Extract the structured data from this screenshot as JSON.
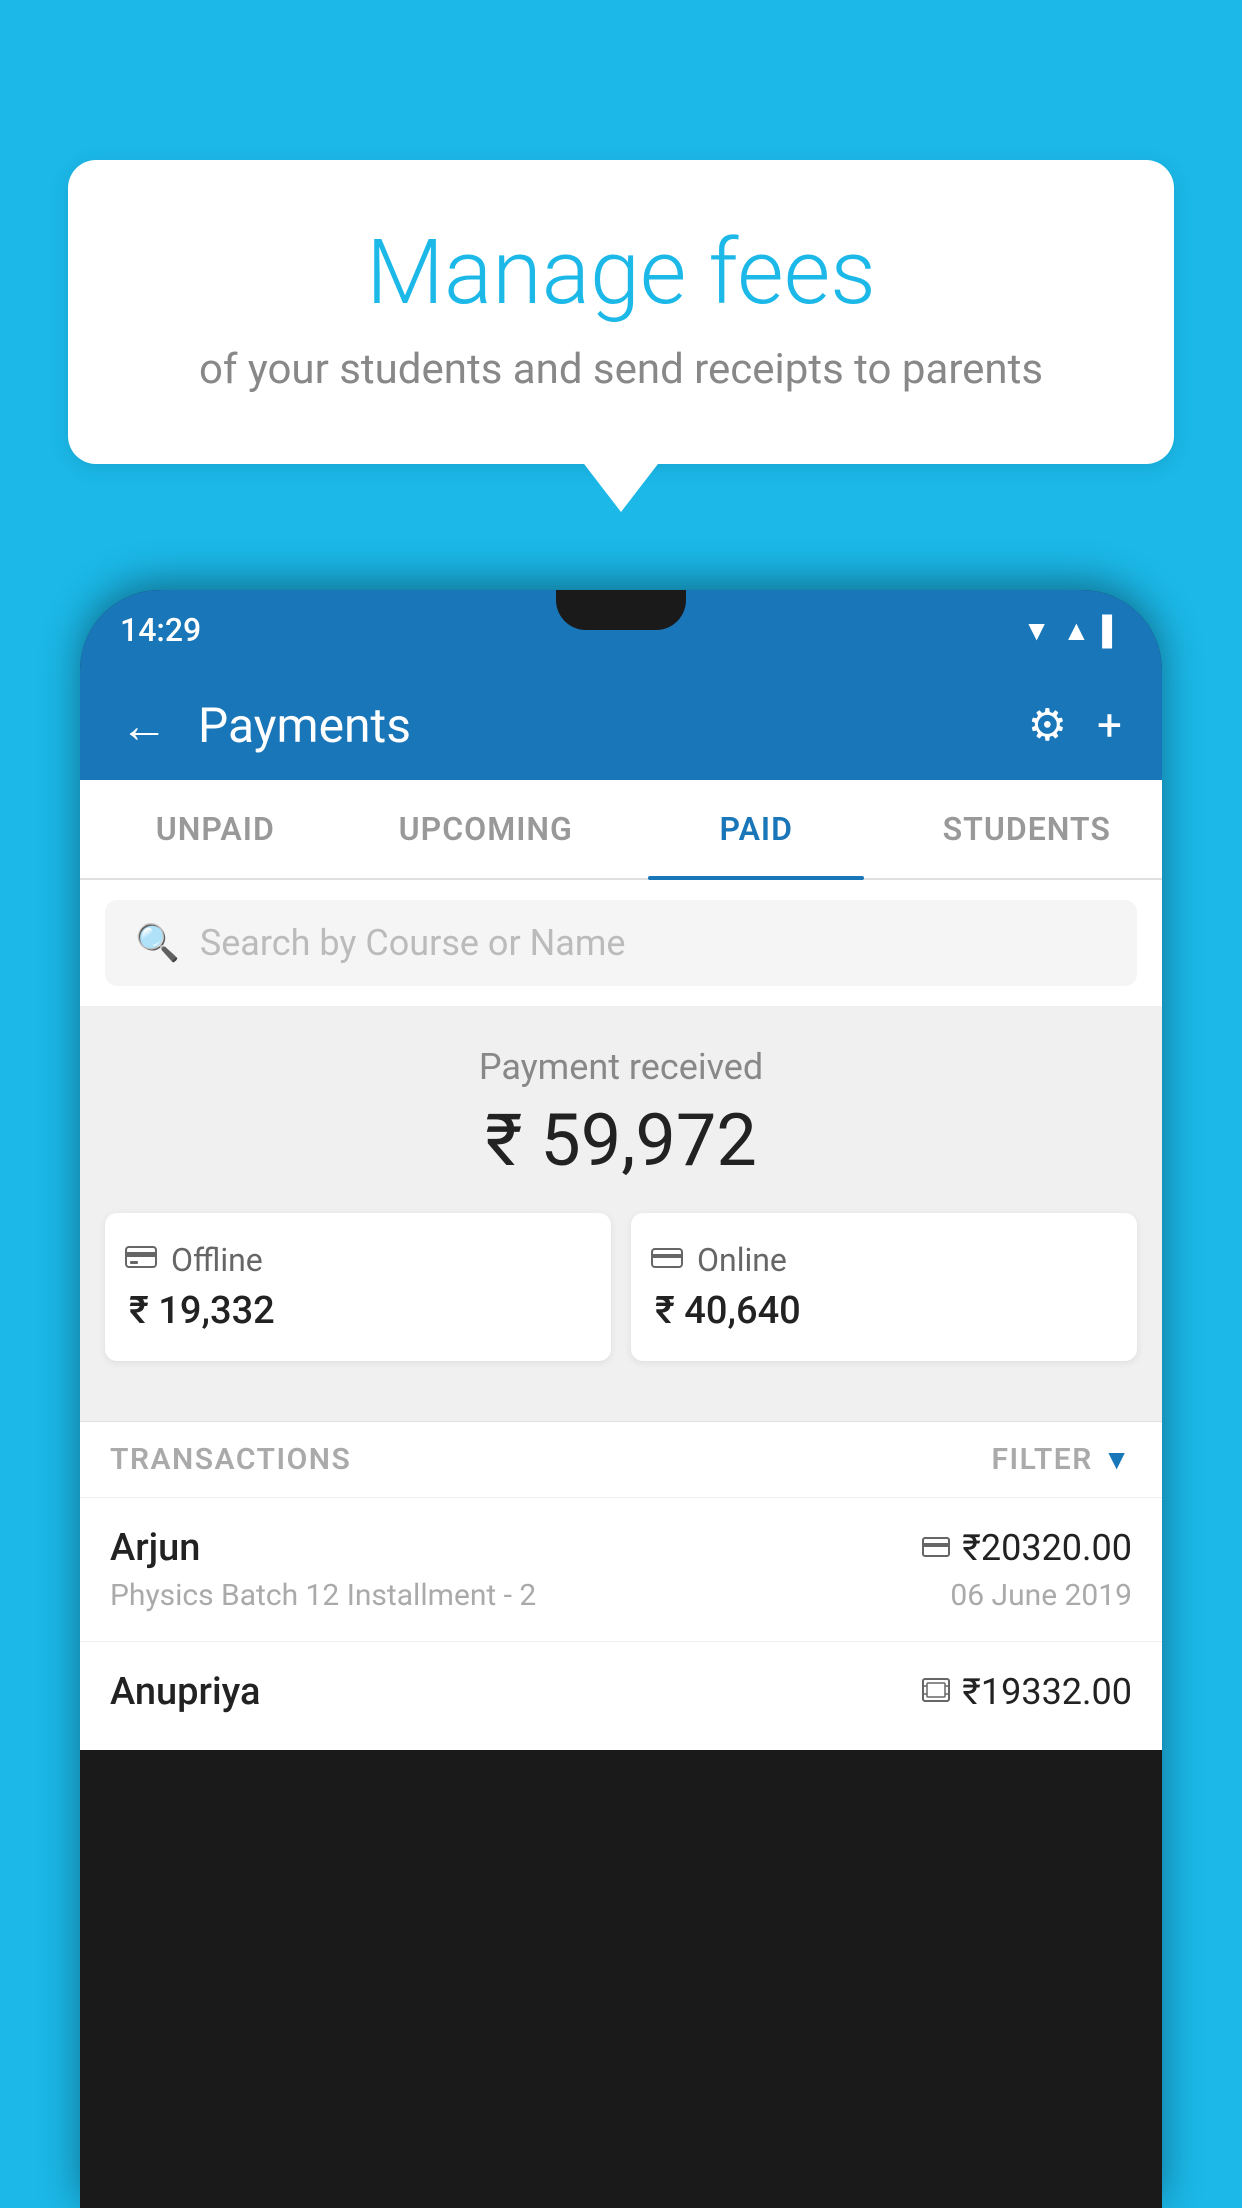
{
  "background_color": "#1BB8E8",
  "bubble": {
    "title": "Manage fees",
    "subtitle": "of your students and send receipts to parents"
  },
  "status_bar": {
    "time": "14:29",
    "icons": [
      "▼",
      "▲",
      "▌"
    ]
  },
  "header": {
    "title": "Payments",
    "back_label": "←",
    "gear_label": "⚙",
    "plus_label": "+"
  },
  "tabs": [
    {
      "label": "UNPAID",
      "active": false
    },
    {
      "label": "UPCOMING",
      "active": false
    },
    {
      "label": "PAID",
      "active": true
    },
    {
      "label": "STUDENTS",
      "active": false
    }
  ],
  "search": {
    "placeholder": "Search by Course or Name"
  },
  "payment_summary": {
    "label": "Payment received",
    "total": "₹ 59,972",
    "offline": {
      "icon": "💳",
      "label": "Offline",
      "amount": "₹ 19,332"
    },
    "online": {
      "icon": "💳",
      "label": "Online",
      "amount": "₹ 40,640"
    }
  },
  "transactions": {
    "label": "TRANSACTIONS",
    "filter_label": "FILTER",
    "rows": [
      {
        "name": "Arjun",
        "amount": "₹20320.00",
        "course": "Physics Batch 12 Installment - 2",
        "date": "06 June 2019",
        "icon_type": "card"
      },
      {
        "name": "Anupriya",
        "amount": "₹19332.00",
        "course": "",
        "date": "",
        "icon_type": "cash"
      }
    ]
  }
}
